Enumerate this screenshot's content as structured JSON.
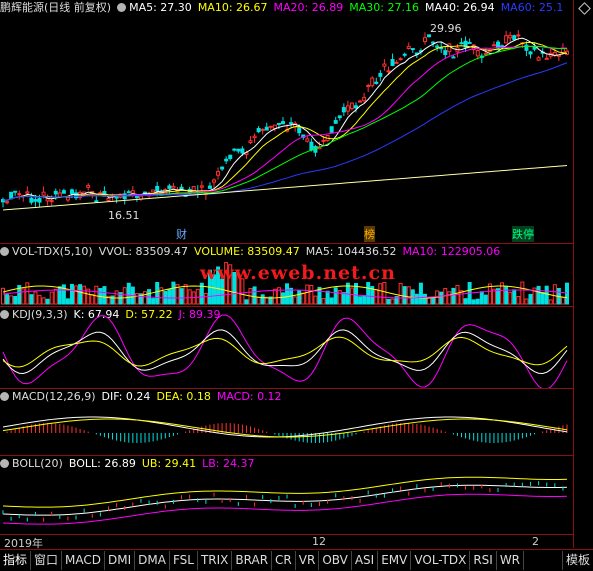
{
  "main": {
    "title": "鹏辉能源(日线 前复权)",
    "ma5": "MA5: 27.30",
    "ma10": "MA10: 26.67",
    "ma20": "MA20: 26.89",
    "ma30": "MA30: 27.16",
    "ma40": "MA40: 26.94",
    "ma60": "MA60: 25.1",
    "high_label": "29.96",
    "low_label": "16.51",
    "tag_cai": "财",
    "tag_bang": "榜",
    "tag_dieting": "跌停",
    "colors": {
      "ma5": "#ffffff",
      "ma10": "#ffff00",
      "ma20": "#ff00ff",
      "ma30": "#00ff00",
      "ma40": "#ffffff",
      "ma60": "#0000ff"
    }
  },
  "vol": {
    "name": "VOL-TDX(5,10)",
    "vvol": "VVOL: 83509.47",
    "volume": "VOLUME: 83509.47",
    "ma5": "MA5: 104436.52",
    "ma10": "MA10: 122905.06"
  },
  "watermark": "www.eweb.net.cn",
  "kdj": {
    "name": "KDJ(9,3,3)",
    "k": "K: 67.94",
    "d": "D: 57.22",
    "j": "J: 89.39"
  },
  "macd": {
    "name": "MACD(12,26,9)",
    "dif": "DIF: 0.24",
    "dea": "DEA: 0.18",
    "macd": "MACD: 0.12"
  },
  "boll": {
    "name": "BOLL(20)",
    "boll": "BOLL: 26.89",
    "ub": "UB: 29.41",
    "lb": "LB: 24.37"
  },
  "axis": {
    "year": "2019年",
    "month_12": "12",
    "month_2": "2"
  },
  "tabs": [
    "指标",
    "窗口",
    "MACD",
    "DMI",
    "DMA",
    "FSL",
    "TRIX",
    "BRAR",
    "CR",
    "VR",
    "OBV",
    "ASI",
    "EMV",
    "VOL-TDX",
    "RSI",
    "WR",
    "模板"
  ]
}
